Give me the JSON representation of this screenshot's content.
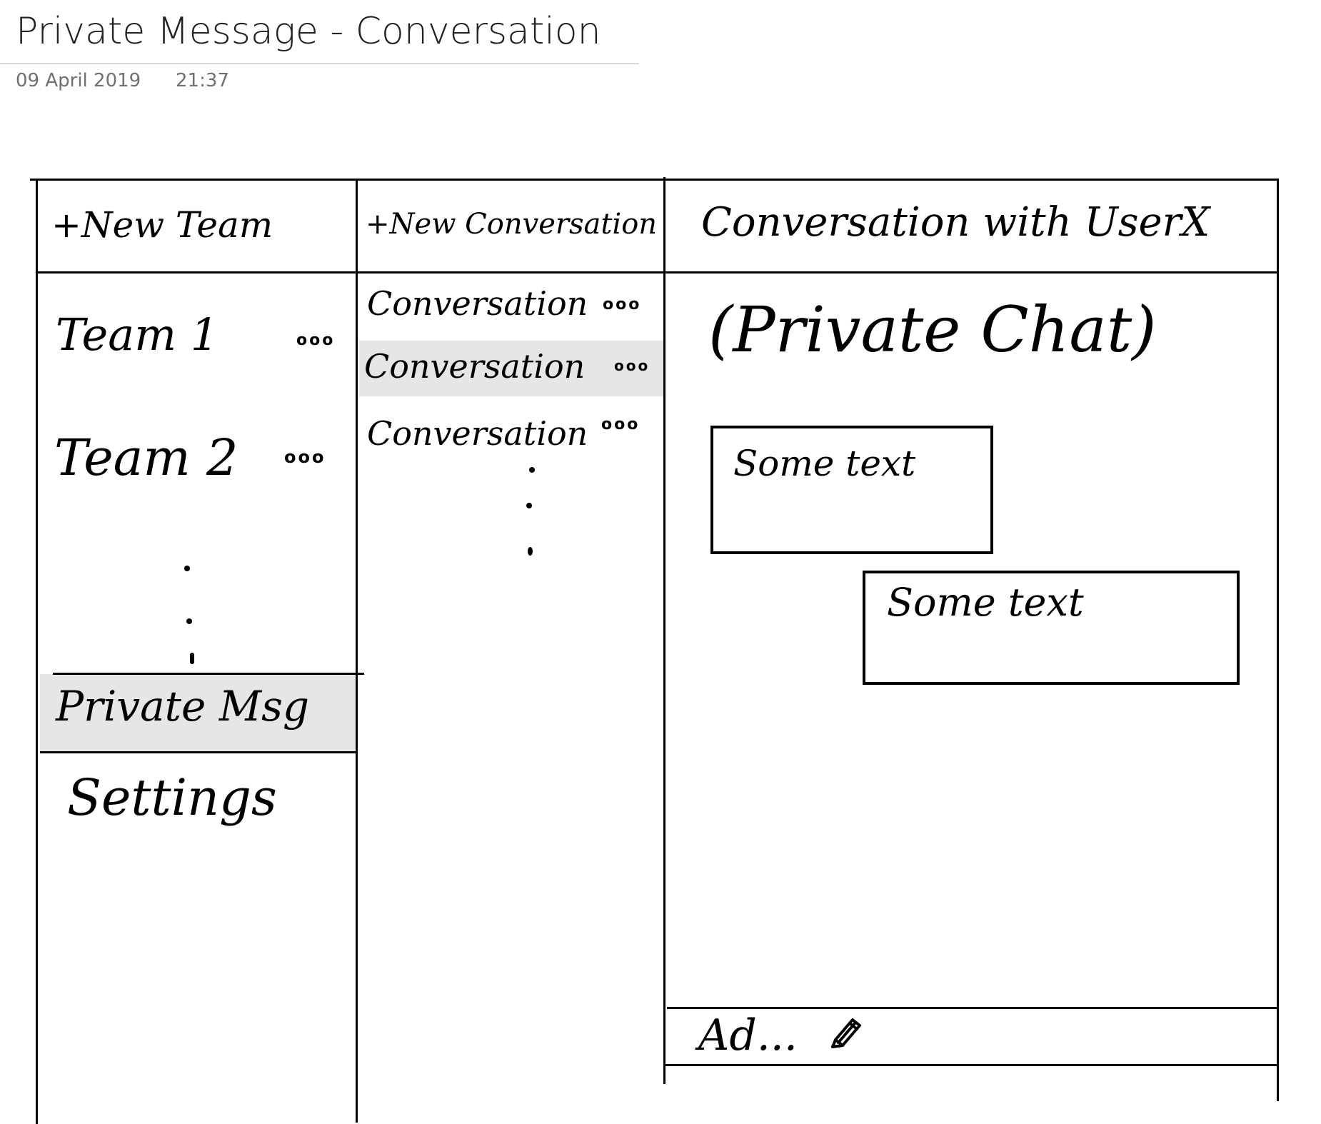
{
  "page": {
    "title": "Private Message - Conversation",
    "date": "09 April 2019",
    "time": "21:37"
  },
  "teams_column": {
    "new_team_label": "+New Team",
    "teams": [
      {
        "label": "Team 1",
        "menu": "ooo"
      },
      {
        "label": "Team 2",
        "menu": "ooo"
      }
    ],
    "private_msg_label": "Private Msg",
    "settings_label": "Settings"
  },
  "conversations_column": {
    "new_conversation_label": "+New Conversation",
    "conversations": [
      {
        "label": "Conversation",
        "menu": "ooo",
        "selected": false
      },
      {
        "label": "Conversation",
        "menu": "ooo",
        "selected": true
      },
      {
        "label": "Conversation",
        "menu": "ooo",
        "selected": false
      }
    ]
  },
  "chat_column": {
    "header": "Conversation with UserX",
    "subtitle": "(Private Chat)",
    "messages": [
      {
        "text": "Some text"
      },
      {
        "text": "Some text"
      }
    ],
    "input_placeholder": "Ad...",
    "input_icon": "pencil-icon"
  },
  "colors": {
    "selected_bg": "#e6e6e6",
    "ink": "#000000"
  }
}
